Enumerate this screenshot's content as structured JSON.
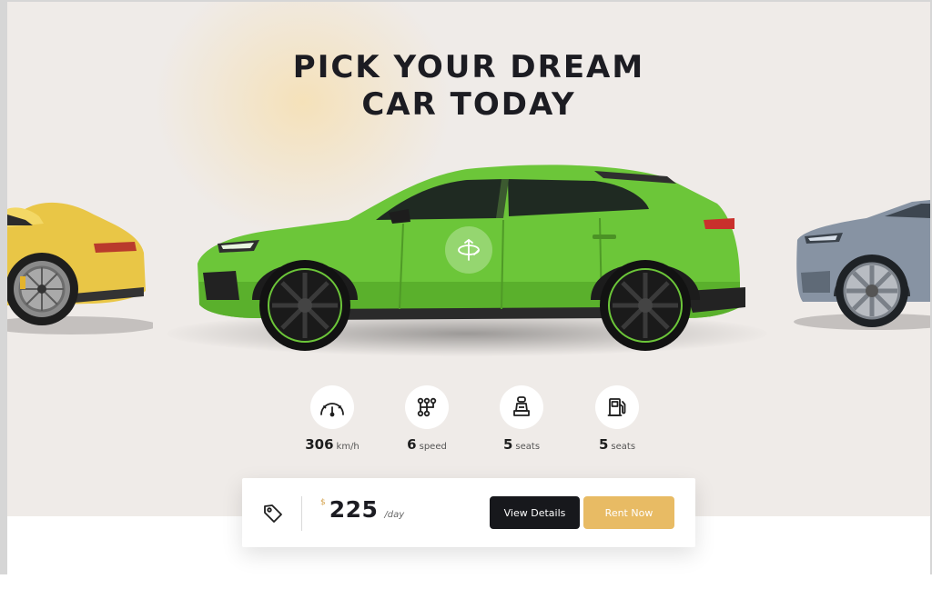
{
  "hero": {
    "title_line1": "PICK YOUR DREAM",
    "title_line2": "CAR TODAY"
  },
  "cars": {
    "left": "yellow-sports-coupe",
    "center": "green-suv",
    "right": "grey-suv"
  },
  "colors": {
    "stage_bg": "#efebe8",
    "accent": "#e8bb64",
    "dark": "#17181c",
    "center_car": "#6cc639"
  },
  "specs": [
    {
      "icon": "speedometer-icon",
      "value": "306",
      "unit": "km/h"
    },
    {
      "icon": "gearbox-icon",
      "value": "6",
      "unit": "speed"
    },
    {
      "icon": "car-seat-icon",
      "value": "5",
      "unit": "seats"
    },
    {
      "icon": "fuel-pump-icon",
      "value": "5",
      "unit": "seats"
    }
  ],
  "price": {
    "currency": "$",
    "amount": "225",
    "period": "/day"
  },
  "buttons": {
    "details": "View Details",
    "rent": "Rent Now"
  }
}
